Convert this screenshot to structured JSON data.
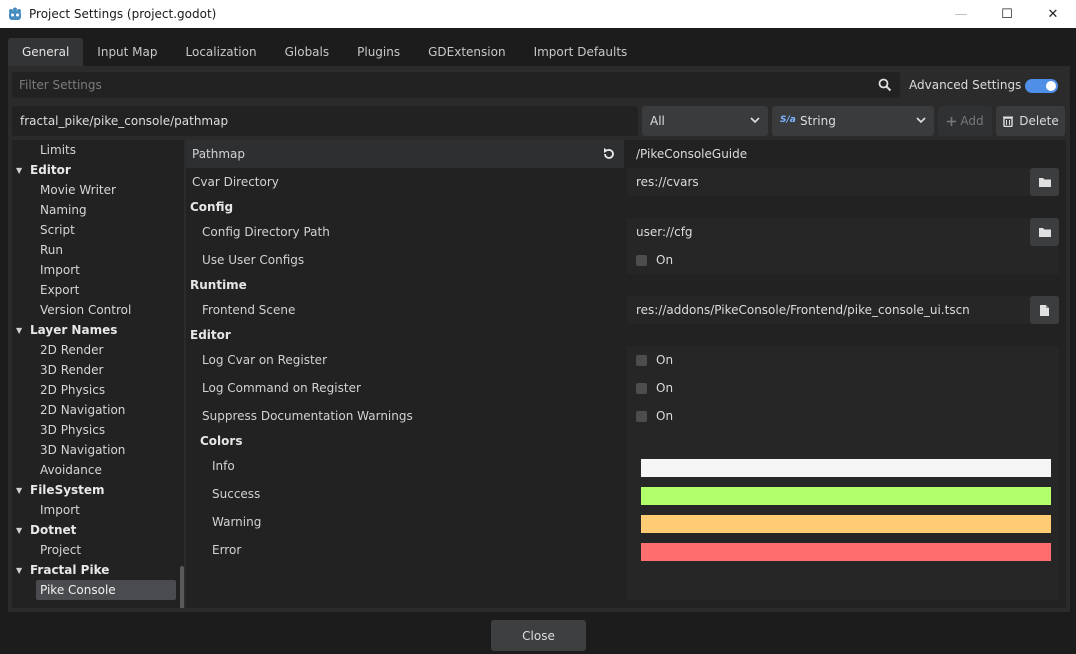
{
  "window": {
    "title": "Project Settings (project.godot)",
    "controls": {
      "minimize": "—",
      "maximize": "☐",
      "close": "✕"
    }
  },
  "tabs": [
    "General",
    "Input Map",
    "Localization",
    "Globals",
    "Plugins",
    "GDExtension",
    "Import Defaults"
  ],
  "filter": {
    "placeholder": "Filter Settings",
    "icon": "search-icon"
  },
  "advanced": {
    "label": "Advanced Settings",
    "enabled": true,
    "accent": "#4f8fe8"
  },
  "path_row": {
    "path": "fractal_pike/pike_console/pathmap",
    "filter_select": "All",
    "type_select": "String",
    "type_icon": "S/a",
    "add_label": "Add",
    "delete_label": "Delete"
  },
  "tree": {
    "items": [
      {
        "label": "Limits",
        "kind": "child"
      },
      {
        "label": "Editor",
        "kind": "section"
      },
      {
        "label": "Movie Writer",
        "kind": "child"
      },
      {
        "label": "Naming",
        "kind": "child"
      },
      {
        "label": "Script",
        "kind": "child"
      },
      {
        "label": "Run",
        "kind": "child"
      },
      {
        "label": "Import",
        "kind": "child"
      },
      {
        "label": "Export",
        "kind": "child"
      },
      {
        "label": "Version Control",
        "kind": "child"
      },
      {
        "label": "Layer Names",
        "kind": "section"
      },
      {
        "label": "2D Render",
        "kind": "child"
      },
      {
        "label": "3D Render",
        "kind": "child"
      },
      {
        "label": "2D Physics",
        "kind": "child"
      },
      {
        "label": "2D Navigation",
        "kind": "child"
      },
      {
        "label": "3D Physics",
        "kind": "child"
      },
      {
        "label": "3D Navigation",
        "kind": "child"
      },
      {
        "label": "Avoidance",
        "kind": "child"
      },
      {
        "label": "FileSystem",
        "kind": "section"
      },
      {
        "label": "Import",
        "kind": "child"
      },
      {
        "label": "Dotnet",
        "kind": "section"
      },
      {
        "label": "Project",
        "kind": "child"
      },
      {
        "label": "Fractal Pike",
        "kind": "section"
      },
      {
        "label": "Pike Console",
        "kind": "selected"
      }
    ]
  },
  "inspector": {
    "pathmap": {
      "label": "Pathmap",
      "value": "/PikeConsoleGuide"
    },
    "cvar_directory": {
      "label": "Cvar Directory",
      "value": "res://cvars"
    },
    "config": {
      "title": "Config",
      "directory_path": {
        "label": "Config Directory Path",
        "value": "user://cfg"
      },
      "use_user_configs": {
        "label": "Use User Configs",
        "value": "On"
      }
    },
    "runtime": {
      "title": "Runtime",
      "frontend_scene": {
        "label": "Frontend Scene",
        "value": "res://addons/PikeConsole/Frontend/pike_console_ui.tscn"
      }
    },
    "editor": {
      "title": "Editor",
      "log_cvar": {
        "label": "Log Cvar on Register",
        "value": "On"
      },
      "log_command": {
        "label": "Log Command on Register",
        "value": "On"
      },
      "suppress_docs": {
        "label": "Suppress Documentation Warnings",
        "value": "On"
      }
    },
    "colors": {
      "title": "Colors",
      "info": {
        "label": "Info",
        "color": "#f5f5f5"
      },
      "success": {
        "label": "Success",
        "color": "#b0ff6b"
      },
      "warning": {
        "label": "Warning",
        "color": "#ffcc73"
      },
      "error": {
        "label": "Error",
        "color": "#ff6e6e"
      }
    }
  },
  "footer": {
    "close_label": "Close"
  }
}
